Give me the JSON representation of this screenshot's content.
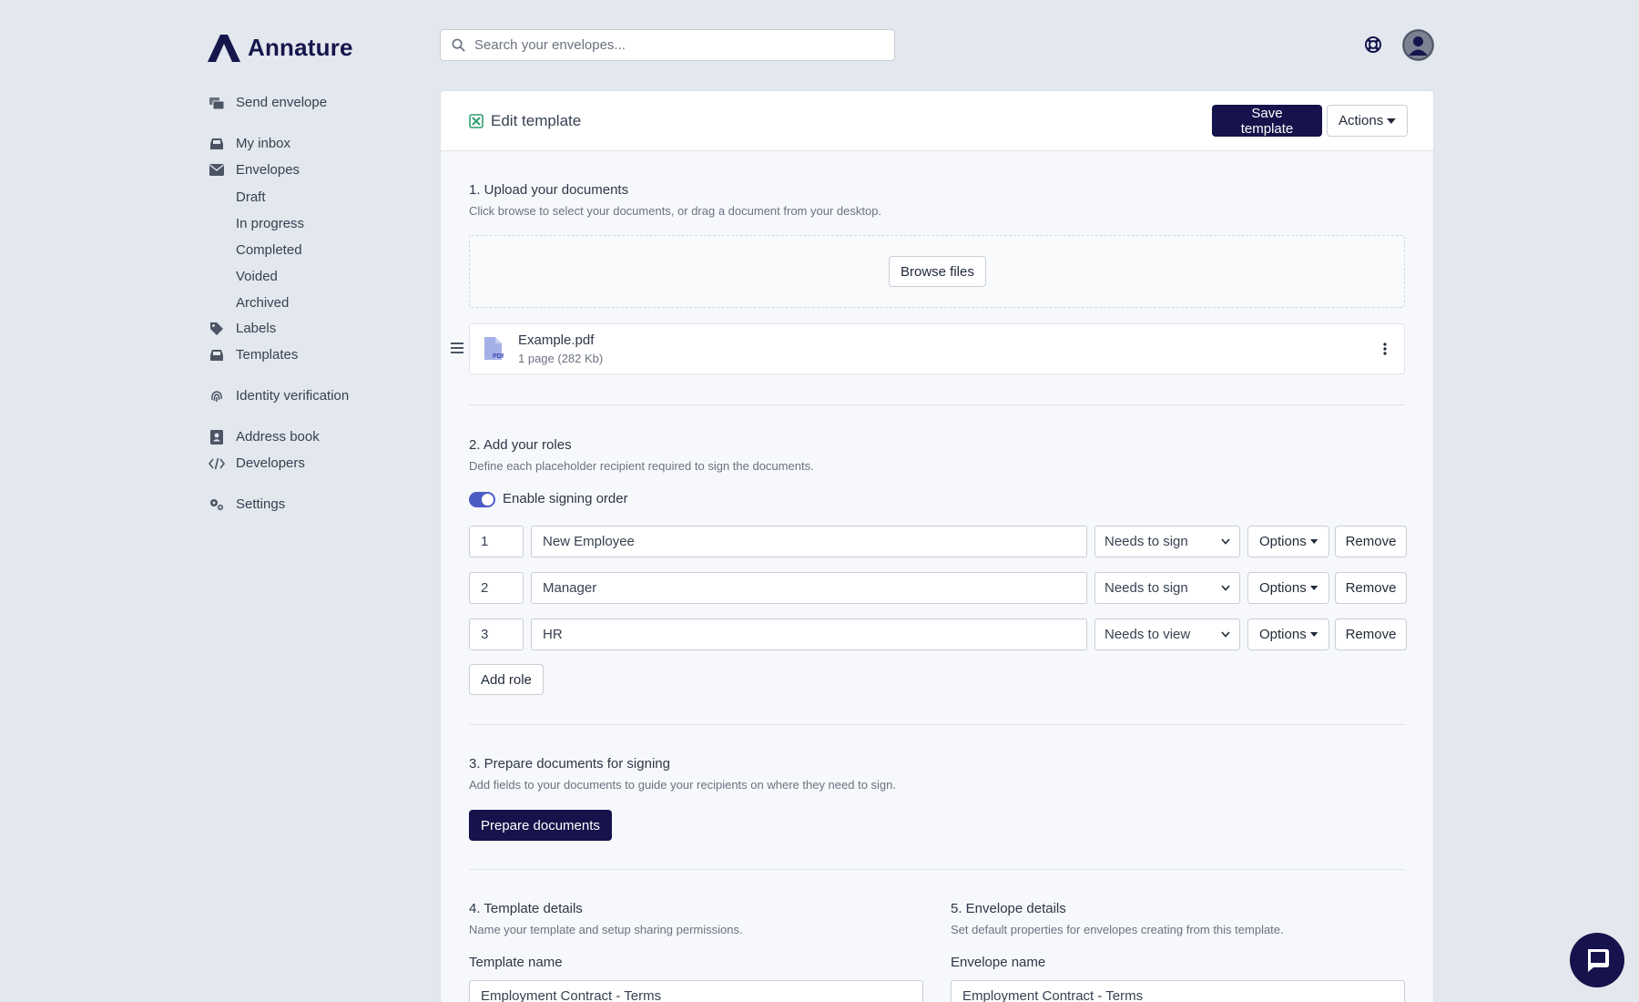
{
  "brand": {
    "name": "Annature",
    "color": "#16154c"
  },
  "search": {
    "placeholder": "Search your envelopes..."
  },
  "sidebar": {
    "send_envelope": "Send envelope",
    "my_inbox": "My inbox",
    "envelopes": "Envelopes",
    "envelope_sub": [
      "Draft",
      "In progress",
      "Completed",
      "Voided",
      "Archived"
    ],
    "labels": "Labels",
    "templates": "Templates",
    "identity_verification": "Identity verification",
    "address_book": "Address book",
    "developers": "Developers",
    "settings": "Settings"
  },
  "card": {
    "title": "Edit template",
    "save_label": "Save template",
    "actions_label": "Actions"
  },
  "upload": {
    "title": "1. Upload your documents",
    "description": "Click browse to select your documents, or drag a document from your desktop.",
    "browse_label": "Browse files",
    "document": {
      "name": "Example.pdf",
      "meta": "1 page (282 Kb)"
    }
  },
  "roles": {
    "title": "2. Add your roles",
    "description": "Define each placeholder recipient required to sign the documents.",
    "signing_order_label": "Enable signing order",
    "signing_order_enabled": true,
    "items": [
      {
        "order": "1",
        "name": "New Employee",
        "action": "Needs to sign"
      },
      {
        "order": "2",
        "name": "Manager",
        "action": "Needs to sign"
      },
      {
        "order": "3",
        "name": "HR",
        "action": "Needs to view"
      }
    ],
    "options_label": "Options",
    "remove_label": "Remove",
    "add_label": "Add role"
  },
  "prepare": {
    "title": "3. Prepare documents for signing",
    "description": "Add fields to your documents to guide your recipients on where they need to sign.",
    "button_label": "Prepare documents"
  },
  "template_details": {
    "title": "4. Template details",
    "description": "Name your template and setup sharing permissions.",
    "name_label": "Template name",
    "name_value": "Employment Contract - Terms"
  },
  "envelope_details": {
    "title": "5. Envelope details",
    "description": "Set default properties for envelopes creating from this template.",
    "name_label": "Envelope name",
    "name_value": "Employment Contract - Terms"
  },
  "colors": {
    "background": "#e3e7ee",
    "primary": "#16124b",
    "toggle": "#4b5cc4",
    "accent_green": "#2f9e6e"
  }
}
